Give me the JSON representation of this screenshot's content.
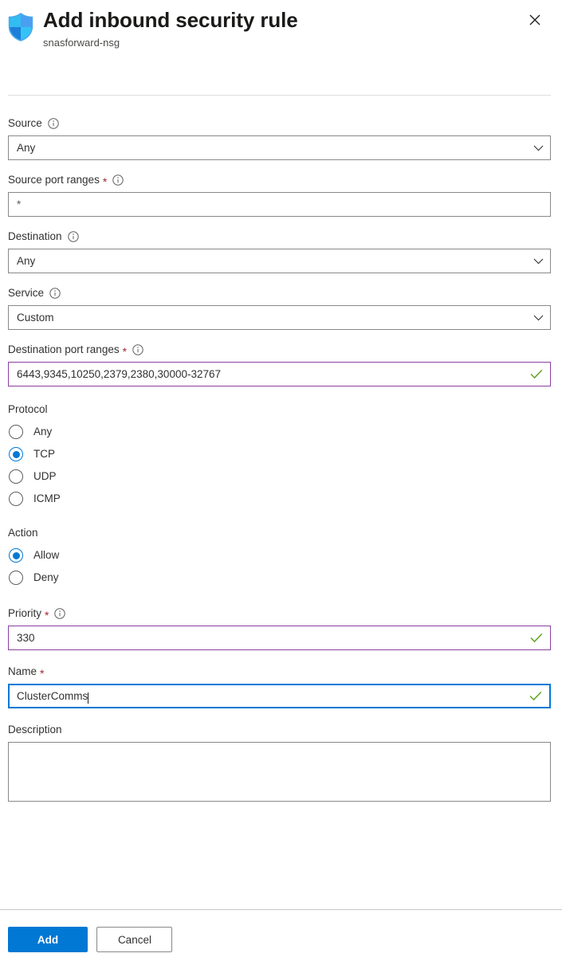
{
  "header": {
    "icon": "network-security-shield-icon",
    "title": "Add inbound security rule",
    "subtitle": "snasforward-nsg",
    "close_label": "×"
  },
  "form": {
    "source": {
      "label": "Source",
      "info": "info-icon",
      "value": "Any",
      "control": "dropdown",
      "required": false
    },
    "source_port_ranges": {
      "label": "Source port ranges",
      "required_marker": "*",
      "info": "info-icon",
      "value": "*",
      "control": "textbox",
      "required": true
    },
    "destination": {
      "label": "Destination",
      "info": "info-icon",
      "value": "Any",
      "control": "dropdown",
      "required": false
    },
    "service": {
      "label": "Service",
      "info": "info-icon",
      "value": "Custom",
      "control": "dropdown",
      "required": false
    },
    "destination_port_ranges": {
      "label": "Destination port ranges",
      "required_marker": "*",
      "info": "info-icon",
      "value": "6443,9345,10250,2379,2380,30000-32767",
      "control": "textbox",
      "required": true,
      "validation": "valid"
    },
    "protocol": {
      "label": "Protocol",
      "selected": "TCP",
      "options": [
        {
          "label": "Any",
          "checked": false
        },
        {
          "label": "TCP",
          "checked": true
        },
        {
          "label": "UDP",
          "checked": false
        },
        {
          "label": "ICMP",
          "checked": false
        }
      ]
    },
    "action": {
      "label": "Action",
      "selected": "Allow",
      "options": [
        {
          "label": "Allow",
          "checked": true
        },
        {
          "label": "Deny",
          "checked": false
        }
      ]
    },
    "priority": {
      "label": "Priority",
      "required_marker": "*",
      "info": "info-icon",
      "value": "330",
      "control": "textbox",
      "required": true,
      "validation": "valid"
    },
    "name": {
      "label": "Name",
      "required_marker": "*",
      "value": "ClusterComms",
      "control": "textbox",
      "required": true,
      "validation": "valid",
      "focused": true
    },
    "description": {
      "label": "Description",
      "value": "",
      "control": "textarea",
      "required": false
    }
  },
  "footer": {
    "add_label": "Add",
    "cancel_label": "Cancel"
  },
  "colors": {
    "accent": "#0078d4",
    "valid_border": "#8c3ea0",
    "valid_check": "#5fa425",
    "required_star": "#a4262c",
    "border": "#8a8886",
    "divider": "#e1dfdd"
  }
}
